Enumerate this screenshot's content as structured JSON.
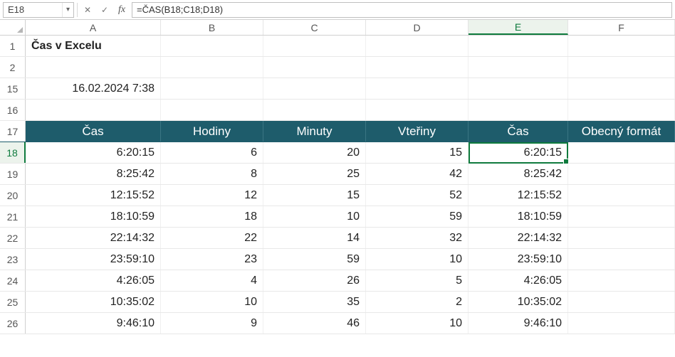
{
  "formula_bar": {
    "cell_ref": "E18",
    "formula": "=ČAS(B18;C18;D18)"
  },
  "columns": [
    "A",
    "B",
    "C",
    "D",
    "E",
    "F"
  ],
  "active_column": "E",
  "active_row": "18",
  "title_cell": "Čas v Excelu",
  "timestamp": "16.02.2024 7:38",
  "row_numbers": [
    "1",
    "2",
    "15",
    "16",
    "17",
    "18",
    "19",
    "20",
    "21",
    "22",
    "23",
    "24",
    "25",
    "26"
  ],
  "table_headers": {
    "A": "Čas",
    "B": "Hodiny",
    "C": "Minuty",
    "D": "Vteřiny",
    "E": "Čas",
    "F": "Obecný formát"
  },
  "data_rows": [
    {
      "r": "18",
      "A": "6:20:15",
      "B": "6",
      "C": "20",
      "D": "15",
      "E": "6:20:15"
    },
    {
      "r": "19",
      "A": "8:25:42",
      "B": "8",
      "C": "25",
      "D": "42",
      "E": "8:25:42"
    },
    {
      "r": "20",
      "A": "12:15:52",
      "B": "12",
      "C": "15",
      "D": "52",
      "E": "12:15:52"
    },
    {
      "r": "21",
      "A": "18:10:59",
      "B": "18",
      "C": "10",
      "D": "59",
      "E": "18:10:59"
    },
    {
      "r": "22",
      "A": "22:14:32",
      "B": "22",
      "C": "14",
      "D": "32",
      "E": "22:14:32"
    },
    {
      "r": "23",
      "A": "23:59:10",
      "B": "23",
      "C": "59",
      "D": "10",
      "E": "23:59:10"
    },
    {
      "r": "24",
      "A": "4:26:05",
      "B": "4",
      "C": "26",
      "D": "5",
      "E": "4:26:05"
    },
    {
      "r": "25",
      "A": "10:35:02",
      "B": "10",
      "C": "35",
      "D": "2",
      "E": "10:35:02"
    },
    {
      "r": "26",
      "A": "9:46:10",
      "B": "9",
      "C": "46",
      "D": "10",
      "E": "9:46:10"
    }
  ]
}
